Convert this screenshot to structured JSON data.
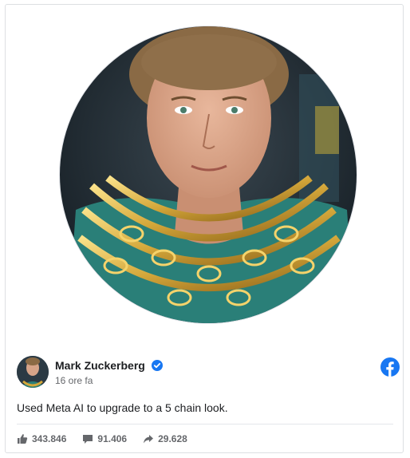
{
  "post": {
    "author": "Mark Zuckerberg",
    "time": "16 ore fa",
    "message": "Used Meta AI to upgrade to a 5 chain look.",
    "verified": true
  },
  "stats": {
    "likes": "343.846",
    "comments": "91.406",
    "shares": "29.628"
  },
  "icons": {
    "verified": "verified-badge-icon",
    "platform": "facebook-icon",
    "like": "thumbs-up-icon",
    "comment": "comment-icon",
    "share": "share-arrow-icon"
  },
  "colors": {
    "facebook_blue": "#1877f2",
    "muted_text": "#65676b",
    "body_text": "#1c1e21",
    "gold": "#d4a73a"
  }
}
